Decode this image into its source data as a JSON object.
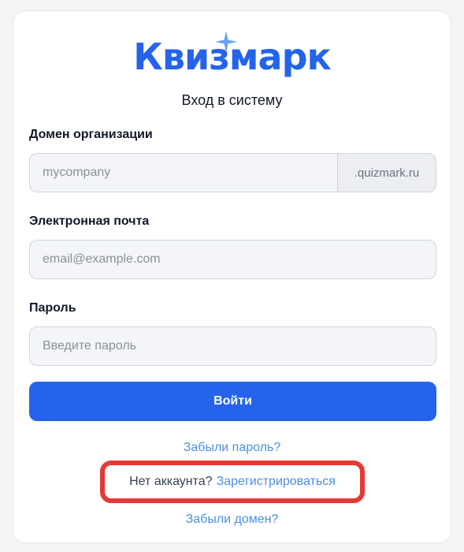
{
  "brand": {
    "logo_text": "Квизмарк",
    "accent_color": "#2563eb"
  },
  "page": {
    "subtitle": "Вход в систему"
  },
  "form": {
    "domain": {
      "label": "Домен организации",
      "placeholder": "mycompany",
      "suffix": ".quizmark.ru"
    },
    "email": {
      "label": "Электронная почта",
      "placeholder": "email@example.com"
    },
    "password": {
      "label": "Пароль",
      "placeholder": "Введите пароль"
    },
    "submit_label": "Войти"
  },
  "links": {
    "forgot_password": "Забыли пароль?",
    "no_account_text": "Нет аккаунта?",
    "register": "Зарегистрироваться",
    "forgot_domain": "Забыли домен?"
  },
  "annotation": {
    "highlight_color": "#e53935"
  }
}
